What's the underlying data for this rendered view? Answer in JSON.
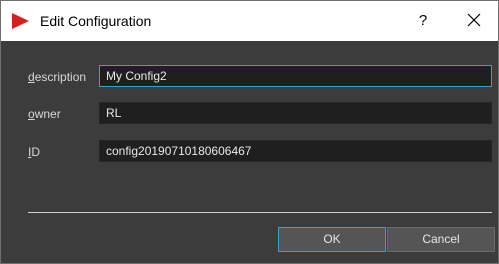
{
  "window": {
    "title": "Edit Configuration",
    "help_label": "?",
    "icon": "app-play-icon",
    "accent_color": "#3f9bd8",
    "icon_color": "#d62020"
  },
  "form": {
    "fields": [
      {
        "mnemonic": "d",
        "label_rest": "escription",
        "value": "My Config2"
      },
      {
        "mnemonic": "o",
        "label_rest": "wner",
        "value": "RL"
      },
      {
        "mnemonic": "I",
        "label_rest": "D",
        "value": "config20190710180606467"
      }
    ]
  },
  "buttons": {
    "ok_label": "OK",
    "cancel_label": "Cancel"
  }
}
